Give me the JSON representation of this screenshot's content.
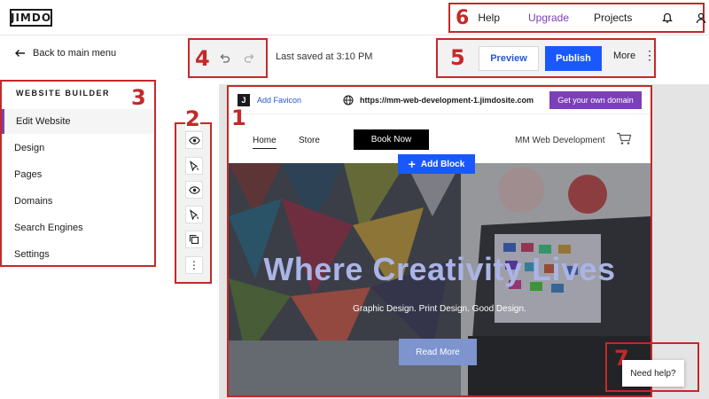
{
  "topbar": {
    "logo": "JIMDO",
    "nav": {
      "help": "Help",
      "upgrade": "Upgrade",
      "projects": "Projects",
      "icons": [
        "bell-icon",
        "user-icon"
      ]
    }
  },
  "leftpanel": {
    "back_label": "Back to main menu",
    "menu_title": "WEBSITE BUILDER",
    "items": [
      "Edit Website",
      "Design",
      "Pages",
      "Domains",
      "Search Engines",
      "Settings"
    ],
    "active_item": "Edit Website"
  },
  "toolbar": {
    "saved_text": "Last saved at 3:10 PM",
    "preview_label": "Preview",
    "publish_label": "Publish",
    "more_label": "More"
  },
  "side_tools": {
    "icons": [
      "eye-icon",
      "paint-icon",
      "eye-icon",
      "paint-icon",
      "copy-icon",
      "more-vertical-icon"
    ]
  },
  "site": {
    "favicon_label": "Add Favicon",
    "url": "https://mm-web-development-1.jimdosite.com",
    "domain_button": "Get your own domain",
    "nav_home": "Home",
    "nav_store": "Store",
    "book_now": "Book Now",
    "brand": "MM Web Development",
    "add_block": "Add Block",
    "hero_headline": "Where Creativity Lives",
    "hero_sub": "Graphic Design. Print Design. Good Design.",
    "read_more": "Read More"
  },
  "help_button": "Need help?",
  "annotations": [
    "1",
    "2",
    "3",
    "4",
    "5",
    "6",
    "7"
  ],
  "colors": {
    "annotation": "#c62828",
    "accent_purple": "#7b3fb8",
    "publish_blue": "#1a58ff"
  }
}
